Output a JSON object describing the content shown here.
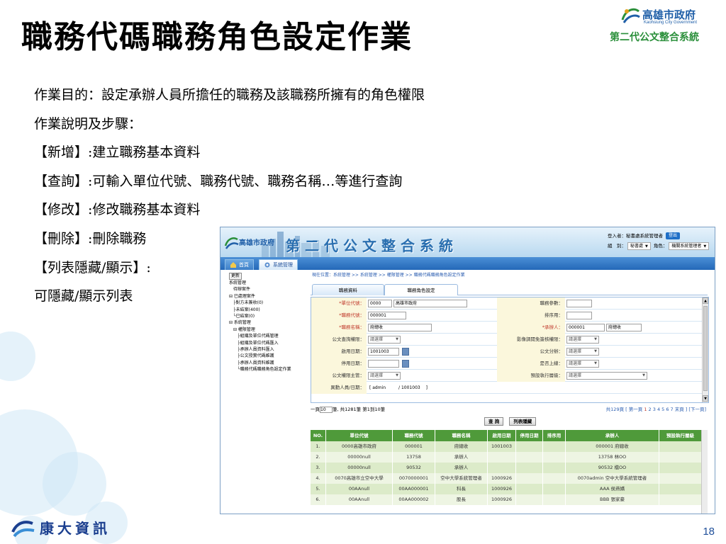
{
  "slide": {
    "title": "職務代碼職務角色設定作業",
    "logo_name": "高雄市政府",
    "logo_eng": "Kaohsiung City Government",
    "logo_sub": "第二代公文整合系統",
    "desc_lines": [
      "作業目的：設定承辦人員所擔任的職務及該職務所擁有的角色權限",
      "作業說明及步驟：",
      "【新增】:建立職務基本資料",
      "【查詢】:可輸入單位代號、職務代號、職務名稱…等進行查詢",
      "【修改】:修改職務基本資料",
      "【刪除】:刪除職務",
      "【列表隱藏/顯示】:",
      "可隱藏/顯示列表"
    ],
    "brand": "康大資訊",
    "page_number": "18"
  },
  "app": {
    "header_logo": "高雄市政府",
    "system_title": "第二代公文整合系統",
    "login_label": "登入者：",
    "login_user": "秘書處系統管理者",
    "logout": "登出",
    "group_label": "組　別：",
    "group_value": "秘書處",
    "role_label": "角色：",
    "role_value": "機關系統管理者",
    "tabs": [
      "首頁",
      "系統管理"
    ]
  },
  "tree": {
    "refresh": "更新",
    "items": [
      "系統管理",
      "　待辦案件",
      "⊟ 已處理案件",
      "　├對方未簽收(0)",
      "　├未結案(400)",
      "　└已結案(0)",
      "⊟ 系統管理",
      "　⊟ 權限管理",
      "　　├組織及單位代碼管理",
      "　　├組織及單位代碼匯入",
      "　　├承辦人員資料匯入",
      "　　├公文授實代碼維護",
      "　　├承辦人員資料維護",
      "　　└職務代碼職務角色設定作業"
    ]
  },
  "content": {
    "breadcrumb": "現在位置：系統管理 >> 系統管理 >> 權限管理 >> 職務代碼職務角色設定作業",
    "tabs": [
      "職務資料",
      "職務角色設定"
    ],
    "form": {
      "unit_code_label": "*單位代號：",
      "unit_code": "0000",
      "unit_name": "高雄市政府",
      "job_code_label": "*職務代號：",
      "job_code": "000001",
      "job_name_label": "*職務名稱：",
      "job_name": "府總收",
      "doc_auth_label": "公文查詢權限：",
      "doc_auth": "請選擇",
      "start_date_label": "啟用日期：",
      "start_date": "1001003",
      "stop_date_label": "停用日期：",
      "stop_date": "",
      "doc_master_label": "公文權限主管：",
      "doc_master": "請選擇",
      "changer_label": "異動人員/日期：",
      "changer": "[ admin　　　/ 1001003　 ]",
      "job_param_label": "職務參數：",
      "job_param": "",
      "sort_label": "排序用：",
      "sort": "",
      "handler_label": "*承辦人：",
      "handler_code": "000001",
      "handler_name": "府總收",
      "img_label": "影像調閱免簽核權限：",
      "img_value": "請選擇",
      "doc_assign_label": "公文分辦：",
      "doc_assign": "請選擇",
      "on_duty_label": "是否上線：",
      "on_duty": "請選擇",
      "exec_level_label": "預設執行層級：",
      "exec_level": "請選擇"
    },
    "pager": {
      "per_page_prefix": "一頁",
      "per_page": "10",
      "summary": "筆, 共1281筆 第1到10筆",
      "pages_text": "共129頁 [ 第一頁 ",
      "current": "1",
      "rest": " 2 3 4 5 6 7 末頁 ] [下一頁]"
    },
    "buttons": [
      "查 詢",
      "列表隱藏"
    ],
    "grid": {
      "columns": [
        "NO.",
        "單位代號",
        "職務代號",
        "職務名稱",
        "啟用日期",
        "停用日期",
        "排序用",
        "承辦人",
        "預設執行層級"
      ],
      "rows": [
        [
          "1.",
          "0000高雄市政府",
          "000001",
          "府總收",
          "1001003",
          "",
          "",
          "000001 府總收",
          ""
        ],
        [
          "2.",
          "00000null",
          "13758",
          "承辦人",
          "",
          "",
          "",
          "13758 林OO",
          ""
        ],
        [
          "3.",
          "00000null",
          "90532",
          "承辦人",
          "",
          "",
          "",
          "90532 檔OO",
          ""
        ],
        [
          "4.",
          "0070高雄市立空中大學",
          "0070000001",
          "空中大學系統管理者",
          "1000926",
          "",
          "",
          "0070admin 空中大學系統管理者",
          ""
        ],
        [
          "5.",
          "00AAnull",
          "00AA000001",
          "科長",
          "1000926",
          "",
          "",
          "AAA 侯燕嬌",
          ""
        ],
        [
          "6.",
          "00AAnull",
          "00AA000002",
          "股長",
          "1000926",
          "",
          "",
          "BBB 張家豪",
          ""
        ]
      ]
    }
  },
  "colors": {
    "grid_header": "#4f9a3a",
    "grid_row_odd": "#dcebc9",
    "grid_row_even": "#eef5e3",
    "accent_blue": "#2468b8",
    "required_red": "#c0392b",
    "brand_blue": "#1b3f8f"
  }
}
